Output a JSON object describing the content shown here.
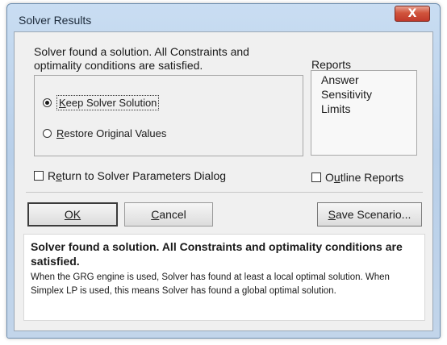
{
  "window": {
    "title": "Solver Results",
    "close_label": "X"
  },
  "message": "Solver found a solution.  All Constraints and optimality conditions are satisfied.",
  "options": {
    "keep": {
      "label": "Keep Solver Solution",
      "checked": true
    },
    "restore": {
      "label": "Restore Original Values",
      "checked": false
    }
  },
  "return_to_dialog": {
    "label": "Return to Solver Parameters Dialog",
    "checked": false
  },
  "reports": {
    "title": "Reports",
    "items": [
      "Answer",
      "Sensitivity",
      "Limits"
    ]
  },
  "outline_reports": {
    "label": "Outline Reports",
    "checked": false
  },
  "buttons": {
    "ok": "OK",
    "cancel": "Cancel",
    "save_scenario": "Save Scenario..."
  },
  "info": {
    "heading": "Solver found a solution.  All Constraints and optimality conditions are satisfied.",
    "body": "When the GRG engine is used, Solver has found at least a local optimal solution. When Simplex LP is used, this means Solver has found a global optimal solution."
  },
  "colors": {
    "frame": "#c2d5ea",
    "close_button": "#c0392b",
    "dialog_background": "#f0f0f0"
  }
}
